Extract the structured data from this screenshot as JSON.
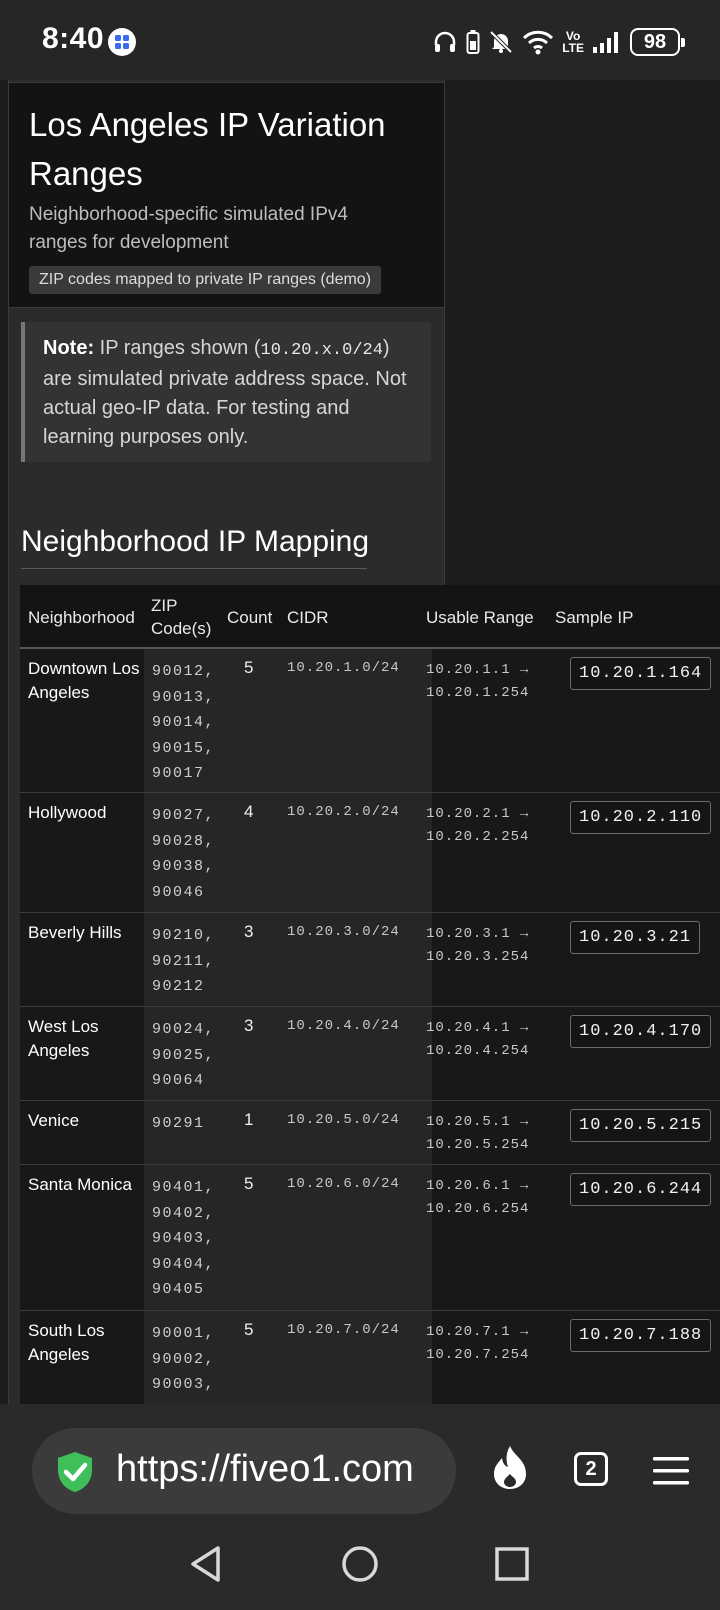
{
  "status_bar": {
    "time": "8:40",
    "battery": "98",
    "volte": [
      "Vo",
      "LTE"
    ],
    "icons": [
      "app-notification-icon",
      "headphones-icon",
      "battery-saver-icon",
      "mute-icon",
      "wifi-icon",
      "volte-icon",
      "signal-icon",
      "battery-icon"
    ]
  },
  "header": {
    "title": "Los Angeles IP Variation Ranges",
    "subtitle": "Neighborhood-specific simulated IPv4 ranges for development",
    "pill": "ZIP codes mapped to private IP ranges (demo)"
  },
  "note": {
    "label": "Note:",
    "text_before": " IP ranges shown (",
    "code": "10.20.x.0/24",
    "text_after": ") are simulated private address space. Not actual geo-IP data. For testing and learning purposes only."
  },
  "section_title": "Neighborhood IP Mapping",
  "table": {
    "headers": {
      "neighborhood": "Neighborhood",
      "zip": "ZIP Code(s)",
      "count": "Count",
      "cidr": "CIDR",
      "range": "Usable Range",
      "sample": "Sample IP"
    },
    "rows": [
      {
        "name": "Downtown Los Angeles",
        "zips": "90012, 90013, 90014, 90015, 90017",
        "count": "5",
        "cidr": "10.20.1.0/24",
        "range": "10.20.1.1 → 10.20.1.254",
        "sample": "10.20.1.164"
      },
      {
        "name": "Hollywood",
        "zips": "90027, 90028, 90038, 90046",
        "count": "4",
        "cidr": "10.20.2.0/24",
        "range": "10.20.2.1 → 10.20.2.254",
        "sample": "10.20.2.110"
      },
      {
        "name": "Beverly Hills",
        "zips": "90210, 90211, 90212",
        "count": "3",
        "cidr": "10.20.3.0/24",
        "range": "10.20.3.1 → 10.20.3.254",
        "sample": "10.20.3.21"
      },
      {
        "name": "West Los Angeles",
        "zips": "90024, 90025, 90064",
        "count": "3",
        "cidr": "10.20.4.0/24",
        "range": "10.20.4.1 → 10.20.4.254",
        "sample": "10.20.4.170"
      },
      {
        "name": "Venice",
        "zips": "90291",
        "count": "1",
        "cidr": "10.20.5.0/24",
        "range": "10.20.5.1 → 10.20.5.254",
        "sample": "10.20.5.215"
      },
      {
        "name": "Santa Monica",
        "zips": "90401, 90402, 90403, 90404, 90405",
        "count": "5",
        "cidr": "10.20.6.0/24",
        "range": "10.20.6.1 → 10.20.6.254",
        "sample": "10.20.6.244"
      },
      {
        "name": "South Los Angeles",
        "zips": "90001, 90002, 90003,",
        "count": "5",
        "cidr": "10.20.7.0/24",
        "range": "10.20.7.1 → 10.20.7.254",
        "sample": "10.20.7.188"
      }
    ]
  },
  "browser": {
    "url": "https://fiveo1.com",
    "tab_count": "2",
    "icons": [
      "secure-shield-icon",
      "flame-icon",
      "tabs-icon",
      "menu-icon"
    ]
  },
  "nav": {
    "icons": [
      "back-icon",
      "home-icon",
      "recents-icon"
    ]
  }
}
